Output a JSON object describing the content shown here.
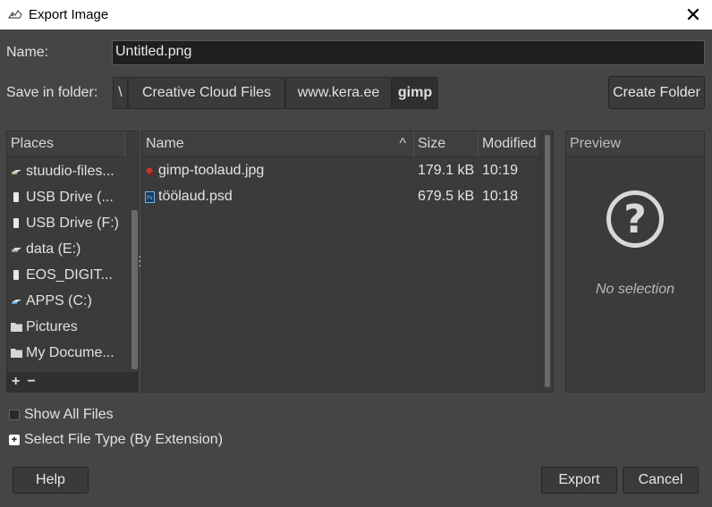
{
  "window": {
    "title": "Export Image",
    "close_glyph": "✕"
  },
  "name_label": "Name:",
  "name_value": "Untitled.png",
  "save_in_label": "Save in folder:",
  "breadcrumbs": [
    "\\",
    "Creative Cloud Files",
    "www.kera.ee",
    "gimp"
  ],
  "create_folder": "Create Folder",
  "places": {
    "header": "Places",
    "items": [
      {
        "label": "stuudio-files...",
        "icon": "network-drive-icon"
      },
      {
        "label": "USB Drive (...",
        "icon": "usb-drive-icon"
      },
      {
        "label": "USB Drive (F:)",
        "icon": "usb-drive-icon"
      },
      {
        "label": "data (E:)",
        "icon": "hard-drive-icon"
      },
      {
        "label": "EOS_DIGIT...",
        "icon": "usb-drive-icon"
      },
      {
        "label": "APPS (C:)",
        "icon": "system-drive-icon"
      },
      {
        "label": "Pictures",
        "icon": "folder-icon"
      },
      {
        "label": "My Docume...",
        "icon": "folder-icon"
      }
    ],
    "add": "+",
    "remove": "−"
  },
  "files": {
    "columns": {
      "name": "Name",
      "size": "Size",
      "modified": "Modified",
      "sort_glyph": "^"
    },
    "rows": [
      {
        "name": "gimp-toolaud.jpg",
        "size": "179.1 kB",
        "modified": "10:19",
        "icon": "image-file-icon"
      },
      {
        "name": "töölaud.psd",
        "size": "679.5 kB",
        "modified": "10:18",
        "icon": "psd-file-icon"
      }
    ]
  },
  "preview": {
    "header": "Preview",
    "empty_text": "No selection",
    "glyph": "?"
  },
  "show_all_files": "Show All Files",
  "select_file_type": "Select File Type (By Extension)",
  "buttons": {
    "help": "Help",
    "export": "Export",
    "cancel": "Cancel"
  }
}
